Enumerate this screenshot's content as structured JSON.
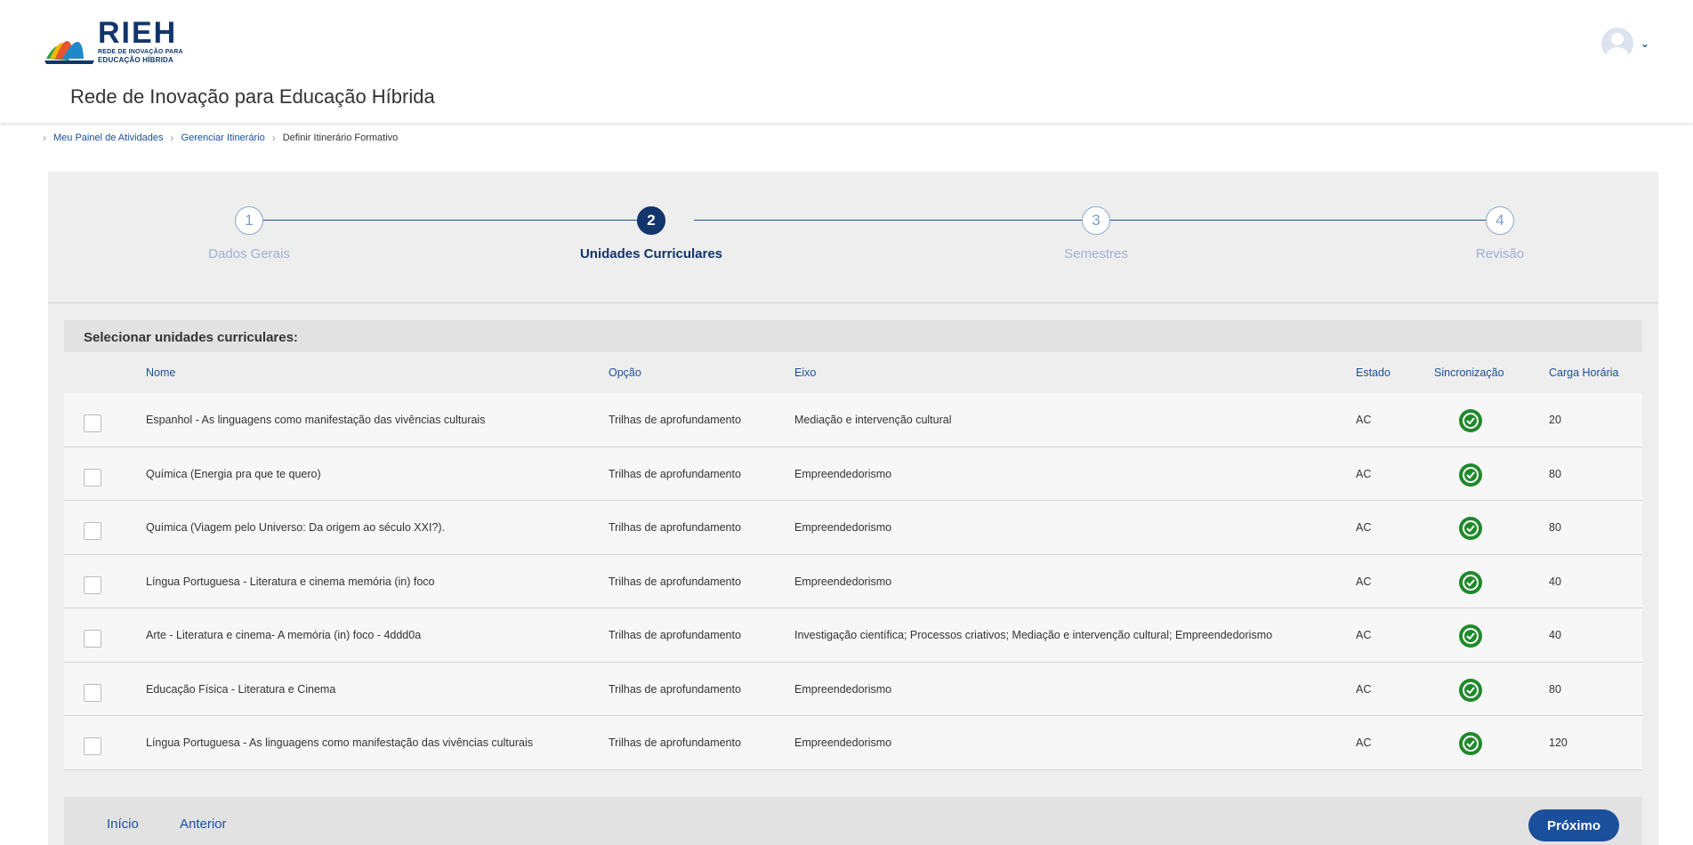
{
  "header": {
    "logo_text": "RIEH",
    "logo_sub1": "REDE DE INOVAÇÃO PARA",
    "logo_sub2": "EDUCAÇÃO HÍBRIDA",
    "site_title": "Rede de Inovação para Educação Híbrida"
  },
  "breadcrumb": {
    "items": [
      "Meu Painel de Atividades",
      "Gerenciar Itinerário",
      "Definir Itinerário Formativo"
    ]
  },
  "stepper": {
    "steps": [
      {
        "number": "1",
        "label": "Dados Gerais"
      },
      {
        "number": "2",
        "label": "Unidades Curriculares"
      },
      {
        "number": "3",
        "label": "Semestres"
      },
      {
        "number": "4",
        "label": "Revisão"
      }
    ]
  },
  "section": {
    "title": "Selecionar unidades curriculares:"
  },
  "table": {
    "headers": [
      "Nome",
      "Opção",
      "Eixo",
      "Estado",
      "Sincronização",
      "Carga Horária"
    ],
    "rows": [
      {
        "nome": "Espanhol - As linguagens como manifestação das vivências culturais",
        "opcao": "Trilhas de aprofundamento",
        "eixo": "Mediação e intervenção cultural",
        "estado": "AC",
        "carga": "20"
      },
      {
        "nome": "Química (Energia pra que te quero)",
        "opcao": "Trilhas de aprofundamento",
        "eixo": "Empreendedorismo",
        "estado": "AC",
        "carga": "80"
      },
      {
        "nome": "Química (Viagem pelo Universo: Da origem ao século XXI?).",
        "opcao": "Trilhas de aprofundamento",
        "eixo": "Empreendedorismo",
        "estado": "AC",
        "carga": "80"
      },
      {
        "nome": "Língua Portuguesa - Literatura e cinema memória (in) foco",
        "opcao": "Trilhas de aprofundamento",
        "eixo": "Empreendedorismo",
        "estado": "AC",
        "carga": "40"
      },
      {
        "nome": "Arte - Literatura e cinema- A memória (in) foco - 4ddd0a",
        "opcao": "Trilhas de aprofundamento",
        "eixo": "Investigação científica; Processos criativos; Mediação e intervenção cultural; Empreendedorismo",
        "estado": "AC",
        "carga": "40"
      },
      {
        "nome": "Educação Física - Literatura e Cinema",
        "opcao": "Trilhas de aprofundamento",
        "eixo": "Empreendedorismo",
        "estado": "AC",
        "carga": "80"
      },
      {
        "nome": "Língua Portuguesa - As linguagens como manifestação das vivências culturais",
        "opcao": "Trilhas de aprofundamento",
        "eixo": "Empreendedorismo",
        "estado": "AC",
        "carga": "120"
      }
    ]
  },
  "footer": {
    "inicio": "Início",
    "anterior": "Anterior",
    "proximo": "Próximo"
  }
}
